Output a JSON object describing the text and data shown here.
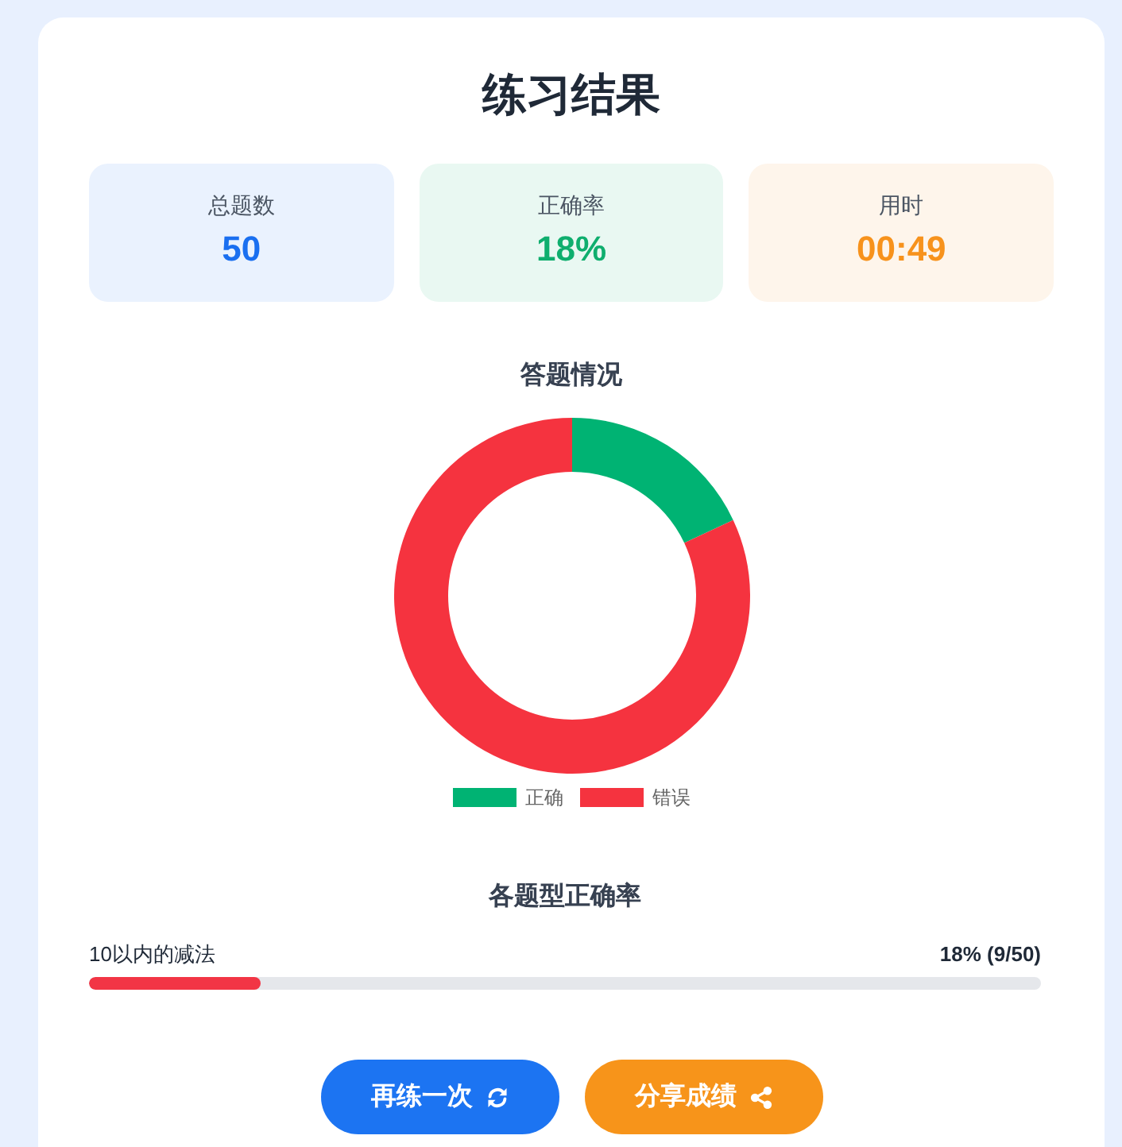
{
  "title": "练习结果",
  "stats": [
    {
      "label": "总题数",
      "value": "50",
      "color": "#1a6ff0"
    },
    {
      "label": "正确率",
      "value": "18%",
      "color": "#0fae6e"
    },
    {
      "label": "用时",
      "value": "00:49",
      "color": "#f7921c"
    }
  ],
  "chart_data": {
    "type": "donut",
    "title": "答题情况",
    "categories": [
      "正确",
      "错误"
    ],
    "values": [
      18,
      82
    ],
    "colors": [
      "#00b373",
      "#f5333f"
    ],
    "legend": "bottom"
  },
  "accuracy": {
    "title": "各题型正确率",
    "items": [
      {
        "label": "10以内的减法",
        "reading": "18% (9/50)",
        "level": 0.18
      }
    ]
  },
  "buttons": [
    {
      "label": "再练一次",
      "kind": "retry"
    },
    {
      "label": "分享成绩",
      "kind": "share"
    }
  ]
}
